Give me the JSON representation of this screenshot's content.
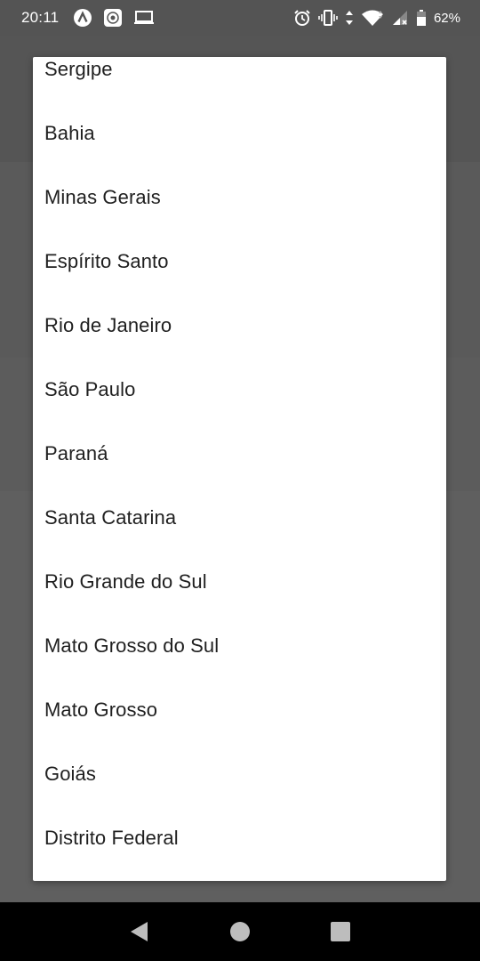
{
  "status_bar": {
    "time": "20:11",
    "battery_percent": "62%",
    "icons": [
      "app-launcher-icon",
      "photo-icon",
      "laptop-icon",
      "alarm-icon",
      "vibrate-icon",
      "data-arrows-icon",
      "wifi-icon",
      "signal-icon",
      "battery-icon"
    ]
  },
  "dialog": {
    "items": [
      "Sergipe",
      "Bahia",
      "Minas Gerais",
      "Espírito Santo",
      "Rio de Janeiro",
      "São Paulo",
      "Paraná",
      "Santa Catarina",
      "Rio Grande do Sul",
      "Mato Grosso do Sul",
      "Mato Grosso",
      "Goiás",
      "Distrito Federal"
    ]
  },
  "nav_bar": {
    "buttons": [
      "back-icon",
      "home-icon",
      "recents-icon"
    ]
  },
  "colors": {
    "scrim": "#5f5f5f",
    "dialog_bg": "#ffffff",
    "text": "#1f1f1f",
    "nav_bar": "#000000",
    "nav_icons": "#bdbdbd"
  }
}
